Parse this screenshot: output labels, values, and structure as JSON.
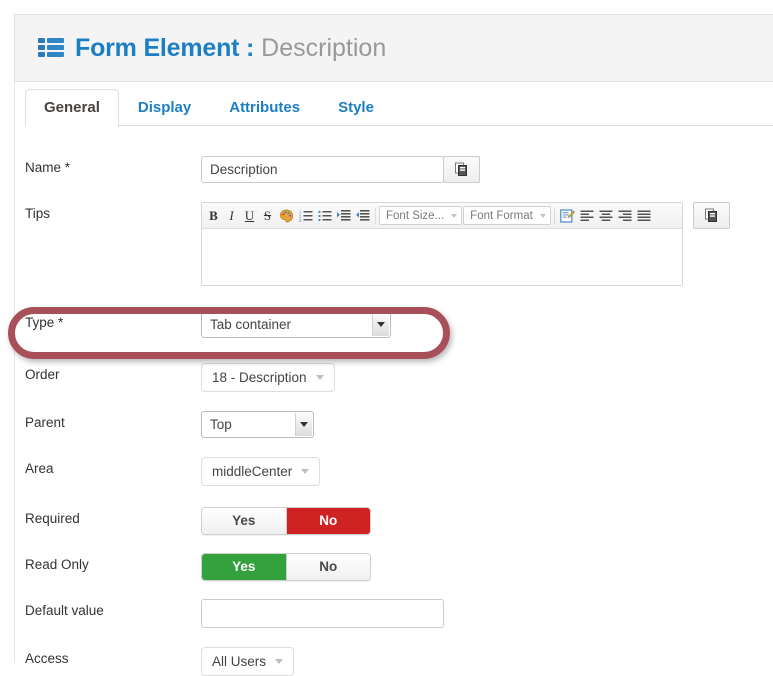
{
  "header": {
    "icon": "list-icon",
    "title": "Form Element :",
    "subtitle": "Description"
  },
  "tabs": [
    {
      "label": "General",
      "active": true
    },
    {
      "label": "Display",
      "active": false
    },
    {
      "label": "Attributes",
      "active": false
    },
    {
      "label": "Style",
      "active": false
    }
  ],
  "form": {
    "name": {
      "label": "Name *",
      "value": "Description",
      "placeholder": "",
      "copy_icon": "copy-icon"
    },
    "tips": {
      "label": "Tips",
      "value": "",
      "copy_icon": "copy-icon",
      "toolbar": {
        "bold": "B",
        "italic": "I",
        "underline": "U",
        "strike": "S",
        "text_color_icon": "palette-icon",
        "ordered_list_icon": "numbered-list-icon",
        "unordered_list_icon": "bullet-list-icon",
        "indent_icon": "indent-icon",
        "outdent_icon": "outdent-icon",
        "font_size": "Font Size...",
        "font_format": "Font Format",
        "source_icon": "edit-source-icon",
        "align_left_icon": "align-left-icon",
        "align_center_icon": "align-center-icon",
        "align_right_icon": "align-right-icon",
        "align_justify_icon": "align-justify-icon"
      }
    },
    "type": {
      "label": "Type *",
      "value": "Tab container"
    },
    "order": {
      "label": "Order",
      "value": "18 - Description"
    },
    "parent": {
      "label": "Parent",
      "value": "Top"
    },
    "area": {
      "label": "Area",
      "value": "middleCenter"
    },
    "required": {
      "label": "Required",
      "yes_label": "Yes",
      "no_label": "No",
      "selected": "No"
    },
    "read_only": {
      "label": "Read Only",
      "yes_label": "Yes",
      "no_label": "No",
      "selected": "Yes"
    },
    "default_value": {
      "label": "Default value",
      "value": "",
      "placeholder": ""
    },
    "access": {
      "label": "Access",
      "value": "All Users"
    }
  },
  "annotation": {
    "shape": "rounded-rectangle-highlight",
    "color": "#a8505a"
  },
  "colors": {
    "accent_blue": "#1d7fc3",
    "toggle_green": "#33a13c",
    "toggle_red": "#cf2222",
    "header_bg": "#f4f4f4",
    "annotation_red": "#a8505a"
  }
}
